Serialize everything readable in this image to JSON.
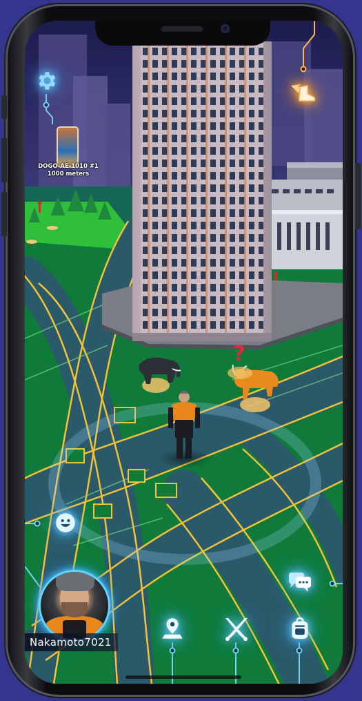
{
  "player": {
    "username": "Nakamoto7021"
  },
  "map_marker": {
    "name": "DOGO-AE-1010 #1",
    "distance": "1000 meters"
  },
  "hud": {
    "top_left": {
      "icon": "gear-icon"
    },
    "top_right": {
      "icon": "winged-boot-icon"
    },
    "left_mid": {
      "icon": "emoji-icon"
    },
    "right_bottom": {
      "icon": "chat-bubbles-icon"
    },
    "bottom_nav": [
      {
        "icon": "map-pin-icon"
      },
      {
        "icon": "crossed-swords-icon"
      },
      {
        "icon": "backpack-icon"
      }
    ]
  },
  "colors": {
    "ground_green": "#0f7a3a",
    "road": "#2a5a6a",
    "road_line": "#f2c23a",
    "sky": "#2c2a6a",
    "hud_glow": "#4fc8ff",
    "accent_orange": "#ff9a2a",
    "phone_background": "#34358e"
  }
}
